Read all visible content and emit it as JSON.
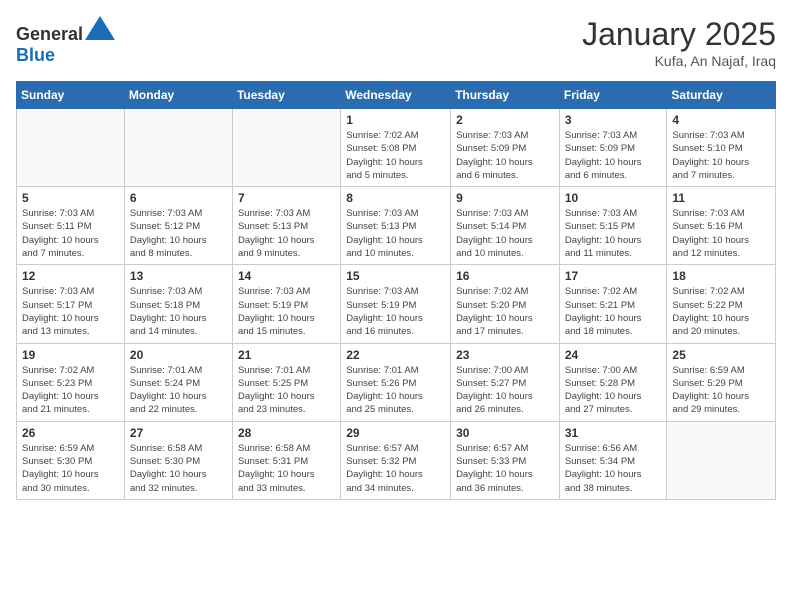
{
  "header": {
    "logo_general": "General",
    "logo_blue": "Blue",
    "month": "January 2025",
    "location": "Kufa, An Najaf, Iraq"
  },
  "weekdays": [
    "Sunday",
    "Monday",
    "Tuesday",
    "Wednesday",
    "Thursday",
    "Friday",
    "Saturday"
  ],
  "weeks": [
    [
      {
        "day": "",
        "info": ""
      },
      {
        "day": "",
        "info": ""
      },
      {
        "day": "",
        "info": ""
      },
      {
        "day": "1",
        "info": "Sunrise: 7:02 AM\nSunset: 5:08 PM\nDaylight: 10 hours\nand 5 minutes."
      },
      {
        "day": "2",
        "info": "Sunrise: 7:03 AM\nSunset: 5:09 PM\nDaylight: 10 hours\nand 6 minutes."
      },
      {
        "day": "3",
        "info": "Sunrise: 7:03 AM\nSunset: 5:09 PM\nDaylight: 10 hours\nand 6 minutes."
      },
      {
        "day": "4",
        "info": "Sunrise: 7:03 AM\nSunset: 5:10 PM\nDaylight: 10 hours\nand 7 minutes."
      }
    ],
    [
      {
        "day": "5",
        "info": "Sunrise: 7:03 AM\nSunset: 5:11 PM\nDaylight: 10 hours\nand 7 minutes."
      },
      {
        "day": "6",
        "info": "Sunrise: 7:03 AM\nSunset: 5:12 PM\nDaylight: 10 hours\nand 8 minutes."
      },
      {
        "day": "7",
        "info": "Sunrise: 7:03 AM\nSunset: 5:13 PM\nDaylight: 10 hours\nand 9 minutes."
      },
      {
        "day": "8",
        "info": "Sunrise: 7:03 AM\nSunset: 5:13 PM\nDaylight: 10 hours\nand 10 minutes."
      },
      {
        "day": "9",
        "info": "Sunrise: 7:03 AM\nSunset: 5:14 PM\nDaylight: 10 hours\nand 10 minutes."
      },
      {
        "day": "10",
        "info": "Sunrise: 7:03 AM\nSunset: 5:15 PM\nDaylight: 10 hours\nand 11 minutes."
      },
      {
        "day": "11",
        "info": "Sunrise: 7:03 AM\nSunset: 5:16 PM\nDaylight: 10 hours\nand 12 minutes."
      }
    ],
    [
      {
        "day": "12",
        "info": "Sunrise: 7:03 AM\nSunset: 5:17 PM\nDaylight: 10 hours\nand 13 minutes."
      },
      {
        "day": "13",
        "info": "Sunrise: 7:03 AM\nSunset: 5:18 PM\nDaylight: 10 hours\nand 14 minutes."
      },
      {
        "day": "14",
        "info": "Sunrise: 7:03 AM\nSunset: 5:19 PM\nDaylight: 10 hours\nand 15 minutes."
      },
      {
        "day": "15",
        "info": "Sunrise: 7:03 AM\nSunset: 5:19 PM\nDaylight: 10 hours\nand 16 minutes."
      },
      {
        "day": "16",
        "info": "Sunrise: 7:02 AM\nSunset: 5:20 PM\nDaylight: 10 hours\nand 17 minutes."
      },
      {
        "day": "17",
        "info": "Sunrise: 7:02 AM\nSunset: 5:21 PM\nDaylight: 10 hours\nand 18 minutes."
      },
      {
        "day": "18",
        "info": "Sunrise: 7:02 AM\nSunset: 5:22 PM\nDaylight: 10 hours\nand 20 minutes."
      }
    ],
    [
      {
        "day": "19",
        "info": "Sunrise: 7:02 AM\nSunset: 5:23 PM\nDaylight: 10 hours\nand 21 minutes."
      },
      {
        "day": "20",
        "info": "Sunrise: 7:01 AM\nSunset: 5:24 PM\nDaylight: 10 hours\nand 22 minutes."
      },
      {
        "day": "21",
        "info": "Sunrise: 7:01 AM\nSunset: 5:25 PM\nDaylight: 10 hours\nand 23 minutes."
      },
      {
        "day": "22",
        "info": "Sunrise: 7:01 AM\nSunset: 5:26 PM\nDaylight: 10 hours\nand 25 minutes."
      },
      {
        "day": "23",
        "info": "Sunrise: 7:00 AM\nSunset: 5:27 PM\nDaylight: 10 hours\nand 26 minutes."
      },
      {
        "day": "24",
        "info": "Sunrise: 7:00 AM\nSunset: 5:28 PM\nDaylight: 10 hours\nand 27 minutes."
      },
      {
        "day": "25",
        "info": "Sunrise: 6:59 AM\nSunset: 5:29 PM\nDaylight: 10 hours\nand 29 minutes."
      }
    ],
    [
      {
        "day": "26",
        "info": "Sunrise: 6:59 AM\nSunset: 5:30 PM\nDaylight: 10 hours\nand 30 minutes."
      },
      {
        "day": "27",
        "info": "Sunrise: 6:58 AM\nSunset: 5:30 PM\nDaylight: 10 hours\nand 32 minutes."
      },
      {
        "day": "28",
        "info": "Sunrise: 6:58 AM\nSunset: 5:31 PM\nDaylight: 10 hours\nand 33 minutes."
      },
      {
        "day": "29",
        "info": "Sunrise: 6:57 AM\nSunset: 5:32 PM\nDaylight: 10 hours\nand 34 minutes."
      },
      {
        "day": "30",
        "info": "Sunrise: 6:57 AM\nSunset: 5:33 PM\nDaylight: 10 hours\nand 36 minutes."
      },
      {
        "day": "31",
        "info": "Sunrise: 6:56 AM\nSunset: 5:34 PM\nDaylight: 10 hours\nand 38 minutes."
      },
      {
        "day": "",
        "info": ""
      }
    ]
  ]
}
